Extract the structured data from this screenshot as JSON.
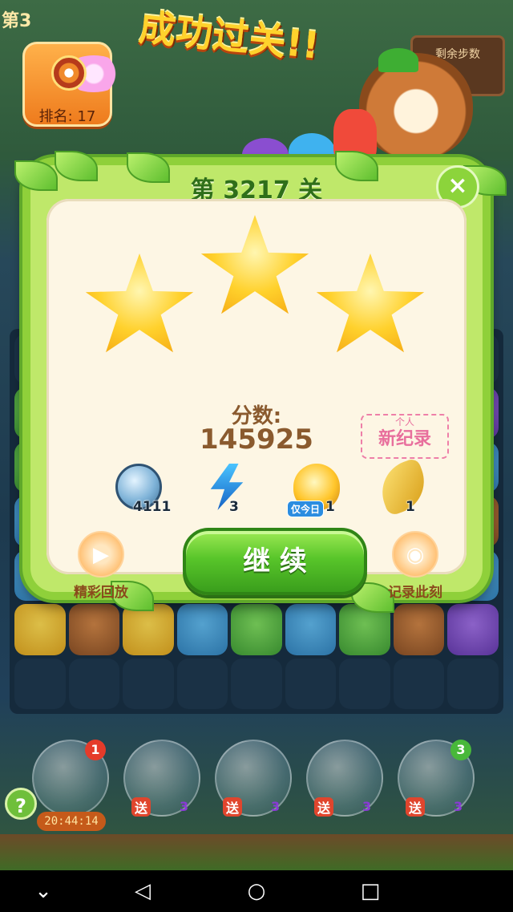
{
  "header": {
    "banner_text": "成功过关!!",
    "level_corner": "第3",
    "rank_label": "排名: 17",
    "steps_sign": "剩余步数"
  },
  "dialog": {
    "level_title": "第 3217 关",
    "close_icon": "×",
    "stars_earned": 3,
    "stars_total": 3,
    "score_label": "分数:",
    "score_value": "145925",
    "new_record_small": "个人",
    "new_record_main": "新纪录",
    "rewards": [
      {
        "icon": "coin-icon",
        "count": "4111"
      },
      {
        "icon": "lightning-icon",
        "count": "3"
      },
      {
        "icon": "potion-icon",
        "count": "1",
        "tag": "仅今日"
      },
      {
        "icon": "golden-bean-icon",
        "count": "1"
      }
    ],
    "replay_label": "精彩回放",
    "continue_label": "继 续",
    "record_label": "记录此刻"
  },
  "boosters": [
    {
      "name": "creature-booster",
      "count": "1",
      "timer": "20:44:14"
    },
    {
      "name": "swap-booster",
      "gift": "送",
      "gift_count": "3"
    },
    {
      "name": "egg-booster",
      "gift": "送",
      "gift_count": "3"
    },
    {
      "name": "hammer-booster",
      "gift": "送",
      "gift_count": "3"
    },
    {
      "name": "star-wand-booster",
      "count": "3",
      "gift": "送",
      "gift_count": "3"
    }
  ],
  "help_label": "?",
  "colors": {
    "dialog_green": "#8fd03a",
    "panel_cream": "#fdf6e4",
    "score_brown": "#8a5a2e",
    "button_green": "#58c52a",
    "record_pink": "#e86f9d",
    "star_gold": "#ffd12c"
  },
  "navigation": [
    "back-icon",
    "home-icon",
    "recents-icon",
    "collapse-icon"
  ]
}
